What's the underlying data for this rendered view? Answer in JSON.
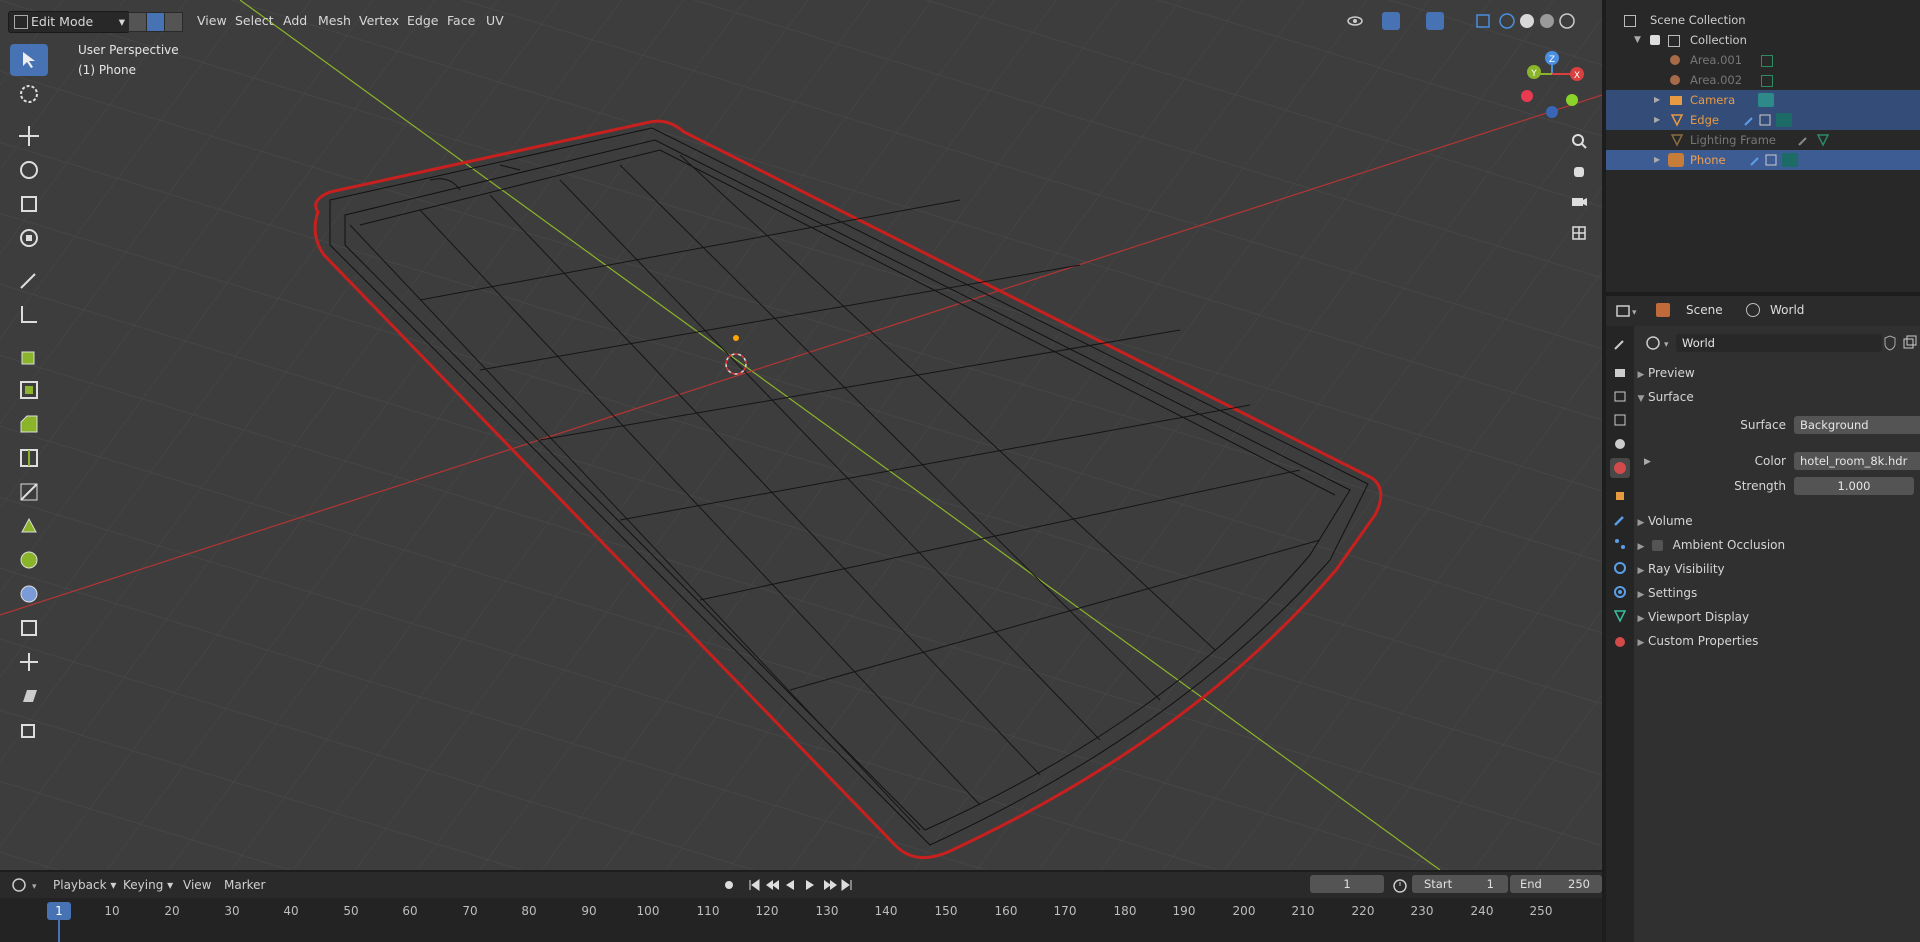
{
  "header": {
    "mode": "Edit Mode",
    "menu": [
      "View",
      "Select",
      "Add",
      "Mesh",
      "Vertex",
      "Edge",
      "Face",
      "UV"
    ]
  },
  "viewport": {
    "perspective_label": "User Perspective",
    "object_label": "(1) Phone",
    "gizmo_axes": [
      "Y",
      "Z",
      "X"
    ]
  },
  "toolbar": {
    "tools": [
      "select-box-icon",
      "cursor-icon",
      "move-icon",
      "rotate-icon",
      "scale-icon",
      "transform-icon",
      "annotate-icon",
      "measure-icon",
      "extrude-icon",
      "inset-icon",
      "bevel-icon",
      "loop-cut-icon",
      "knife-icon",
      "poly-build-icon",
      "spin-icon",
      "smooth-icon",
      "edge-slide-icon",
      "shrink-fatten-icon",
      "shear-icon",
      "rip-icon"
    ]
  },
  "outliner": {
    "root": "Scene Collection",
    "collection": "Collection",
    "items": [
      {
        "name": "Area.001",
        "state": "hidden"
      },
      {
        "name": "Area.002",
        "state": "hidden"
      },
      {
        "name": "Camera",
        "state": "selected"
      },
      {
        "name": "Edge",
        "state": "selected"
      },
      {
        "name": "Lighting Frame",
        "state": "hidden"
      },
      {
        "name": "Phone",
        "state": "active"
      }
    ]
  },
  "properties": {
    "breadcrumb_scene": "Scene",
    "breadcrumb_world": "World",
    "world_name": "World",
    "panels": {
      "preview": "Preview",
      "surface": "Surface",
      "volume": "Volume",
      "ambient_occlusion": "Ambient Occlusion",
      "ray_visibility": "Ray Visibility",
      "settings": "Settings",
      "viewport_display": "Viewport Display",
      "custom_properties": "Custom Properties"
    },
    "surface_label": "Surface",
    "surface_value": "Background",
    "color_label": "Color",
    "color_value": "hotel_room_8k.hdr",
    "strength_label": "Strength",
    "strength_value": "1.000"
  },
  "timeline": {
    "menu": [
      "Playback",
      "Keying",
      "View",
      "Marker"
    ],
    "current_frame": "1",
    "start_label": "Start",
    "start_value": "1",
    "end_label": "End",
    "end_value": "250",
    "ruler": [
      "1",
      "10",
      "20",
      "30",
      "40",
      "50",
      "60",
      "70",
      "80",
      "90",
      "100",
      "110",
      "120",
      "130",
      "140",
      "150",
      "160",
      "170",
      "180",
      "190",
      "200",
      "210",
      "220",
      "230",
      "240",
      "250"
    ]
  },
  "colors": {
    "accent": "#4772b3",
    "edge_red": "#c8201e",
    "axis_x": "#d9403f",
    "axis_y": "#8ab429"
  }
}
